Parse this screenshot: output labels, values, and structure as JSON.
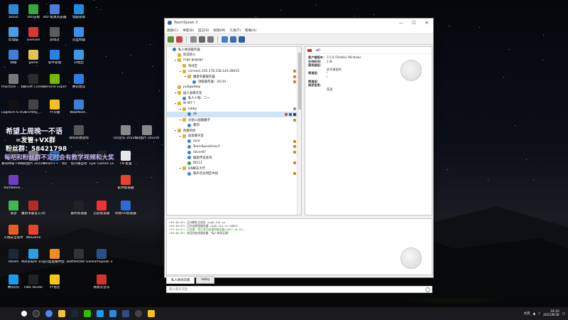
{
  "desktop": {
    "icons": [
      {
        "label": "ailovo",
        "color": "#2b8ad8"
      },
      {
        "label": "360压缩",
        "color": "#3aa640"
      },
      {
        "label": "360 极速浏览器X",
        "color": "#4c7bd9"
      },
      {
        "label": "电脑管家",
        "color": "#1d8de0"
      },
      {
        "label": "TXF配置1",
        "color": "#e8e8e8"
      },
      {
        "label": "此电脑",
        "color": "#4a9de0"
      },
      {
        "label": "GeeGee",
        "color": "#d8383a"
      },
      {
        "label": "游戏过",
        "color": "#5b5b5b"
      },
      {
        "label": "百度网盘",
        "color": "#3a8fe6"
      },
      {
        "label": "网络",
        "color": "#3d7fd6"
      },
      {
        "label": "game",
        "color": "#e6c254"
      },
      {
        "label": "软件管理",
        "color": "#2f7fe0"
      },
      {
        "label": "开始出",
        "color": "#3c9be8"
      },
      {
        "label": "Imjicture ... (1)",
        "color": "#777"
      },
      {
        "label": "Ubisoft Connect",
        "color": "#2b2b2b"
      },
      {
        "label": "GeForce Experience",
        "color": "#76b900"
      },
      {
        "label": "腾讯会议",
        "color": "#2d7fe8"
      },
      {
        "label": "Logitech G HUB",
        "color": "#111"
      },
      {
        "label": "srcrhttp_...",
        "color": "#444"
      },
      {
        "label": "YY开播",
        "color": "#f6c020"
      },
      {
        "label": "WebMeet...",
        "color": "#3a80d8"
      },
      {
        "label": "耳机刺激战场",
        "color": "#555"
      },
      {
        "label": "QQ音乐 20220808...",
        "color": "#888"
      },
      {
        "label": "QQ图片 2022080...",
        "color": "#888"
      },
      {
        "label": "暴风降噪 FINAL BETA",
        "color": "#333"
      },
      {
        "label": "QQ图片 20220815...",
        "color": "#888"
      },
      {
        "label": "Steam++ - 快速方式",
        "color": "#2a6fb8"
      },
      {
        "label": "免开播自动",
        "color": "#222"
      },
      {
        "label": "Epic Games Launcher",
        "color": "#222"
      },
      {
        "label": "TXF配置",
        "color": "#e8e8e8"
      },
      {
        "label": "Rumbleve...",
        "color": "#6c3fc2"
      },
      {
        "label": "速游",
        "color": "#3fb950"
      },
      {
        "label": "魔兽争霸官方对战平台",
        "color": "#b52a2a"
      },
      {
        "label": "最终加速器",
        "color": "#222"
      },
      {
        "label": "迅游加速器",
        "color": "#e33"
      },
      {
        "label": "网易UU加速器",
        "color": "#2e6bd8"
      },
      {
        "label": "火绒安全软件",
        "color": "#e85d22"
      },
      {
        "label": "WeGame",
        "color": "#e8442c"
      },
      {
        "label": "Steam",
        "color": "#1b2838"
      },
      {
        "label": "Wallpaper Engine: ...",
        "color": "#2aa0e0"
      },
      {
        "label": "斗鱼直播伴侣",
        "color": "#f38b24"
      },
      {
        "label": "Battlestate Games L...",
        "color": "#333"
      },
      {
        "label": "TeamSpeak 3",
        "color": "#2a4f86"
      },
      {
        "label": "腾讯QQ",
        "color": "#1a9af0"
      },
      {
        "label": "OBS Studio",
        "color": "#222"
      },
      {
        "label": "YY语音",
        "color": "#f5c518"
      },
      {
        "label": "网易云音乐",
        "color": "#d6322a"
      },
      {
        "label": "雷神加速器",
        "color": "#e8442c"
      }
    ],
    "overlay": {
      "line1": "希望上周晚一不语",
      "line2": "=发管+VX群",
      "line3": "粉丝群：58421798",
      "line4": "每吧和粉丝群不定时会有教学视频和大奖"
    }
  },
  "teamspeak": {
    "title": "TeamSpeak 3",
    "window_buttons": [
      "—",
      "☐",
      "✕"
    ],
    "menu": [
      "连接(C)",
      "书签(B)",
      "自己(S)",
      "权限(M)",
      "工具(T)",
      "帮助(H)"
    ],
    "tree": [
      {
        "label": "私人休闲服务器",
        "indent": 0,
        "exp": "",
        "icon": "server"
      },
      {
        "label": "欢迎进入",
        "indent": 1,
        "exp": "",
        "icon": "channel"
      },
      {
        "label": "csgo gogogo",
        "indent": 1,
        "exp": "▾",
        "icon": "channel"
      },
      {
        "label": "等待区",
        "indent": 2,
        "exp": "",
        "icon": "channel"
      },
      {
        "label": "connect 205.178.158.144:28015",
        "indent": 2,
        "exp": "▾",
        "icon": "channel",
        "lock": true
      },
      {
        "label": "魔兽争霸服务器",
        "indent": 3,
        "exp": "▾",
        "icon": "channel",
        "lock": true
      },
      {
        "label": "顶级服务器：20:44 :",
        "indent": 4,
        "exp": "",
        "icon": "user-blue",
        "lock": true
      },
      {
        "label": "pubgwdwg",
        "indent": 1,
        "exp": "",
        "icon": "channel"
      },
      {
        "label": "国人会聊天室",
        "indent": 1,
        "exp": "▾",
        "icon": "channel"
      },
      {
        "label": "私人人物：二一",
        "indent": 2,
        "exp": "",
        "icon": "user-blue"
      },
      {
        "label": "W W7 ?",
        "indent": 1,
        "exp": "▾",
        "icon": "channel"
      },
      {
        "label": "lobby",
        "indent": 2,
        "exp": "▾",
        "icon": "channel",
        "check": true
      },
      {
        "label": "ali",
        "indent": 3,
        "exp": "",
        "icon": "user-blue",
        "selected": true,
        "flags": true
      },
      {
        "label": "分组cs国服魔子",
        "indent": 2,
        "exp": "▾",
        "icon": "channel",
        "lock": true
      },
      {
        "label": "看到",
        "indent": 3,
        "exp": "",
        "icon": "user-blue"
      },
      {
        "label": "他要听听",
        "indent": 1,
        "exp": "▾",
        "icon": "channel"
      },
      {
        "label": "加班聊天区",
        "indent": 2,
        "exp": "▾",
        "icon": "channel"
      },
      {
        "label": "sync",
        "indent": 3,
        "exp": "",
        "icon": "user-blue",
        "lock": true
      },
      {
        "label": "TeamSpeakUser1",
        "indent": 3,
        "exp": "",
        "icon": "user-blue",
        "lock": true
      },
      {
        "label": "Silver87",
        "indent": 3,
        "exp": "",
        "icon": "user-blue",
        "lock": true
      },
      {
        "label": "偏爱传说查询",
        "indent": 3,
        "exp": "",
        "icon": "user-blue"
      },
      {
        "label": "玩111",
        "indent": 3,
        "exp": "",
        "icon": "user-green",
        "lock": true
      },
      {
        "label": "DN聊天大厅",
        "indent": 2,
        "exp": "▾",
        "icon": "channel"
      },
      {
        "label": "聊声音总和区中组",
        "indent": 3,
        "exp": "",
        "icon": "user-blue",
        "lock": true
      }
    ],
    "info": {
      "nickname": "ali",
      "lines": [
        {
          "k": "客户端版本：",
          "v": "3.5.6 [Stable] Windows"
        },
        {
          "k": "在线时间：",
          "v": "1 秒"
        },
        {
          "k": "服务器组：",
          "v": ""
        },
        {
          "k": "",
          "v": "初学者组的"
        },
        {
          "k": "频道组：",
          "v": "!"
        },
        {
          "k": "",
          "v": "!"
        },
        {
          "k": "频道组：",
          "v": ""
        },
        {
          "k": "描述信息：",
          "v": ""
        },
        {
          "k": "",
          "v": "菜菜"
        }
      ]
    },
    "log": [
      "<19:10:47> 正在解析主机名 vip8.ts3.cn",
      "<19:10:47> 正在连接到服务器 vip8.ts3.cn:10023",
      "<19:10:47> 已连接：您已成功连接到服务器(2022-10-01)",
      "<19:10:47> 欢迎光临本服务器 \"私人休闲云服\""
    ],
    "tabs": [
      "私人休闲云服",
      "lobby"
    ],
    "input_placeholder": "输入聊天消息"
  },
  "taskbar": {
    "tray_text": "大风",
    "time": "19:10",
    "date": "2022/8/30"
  }
}
